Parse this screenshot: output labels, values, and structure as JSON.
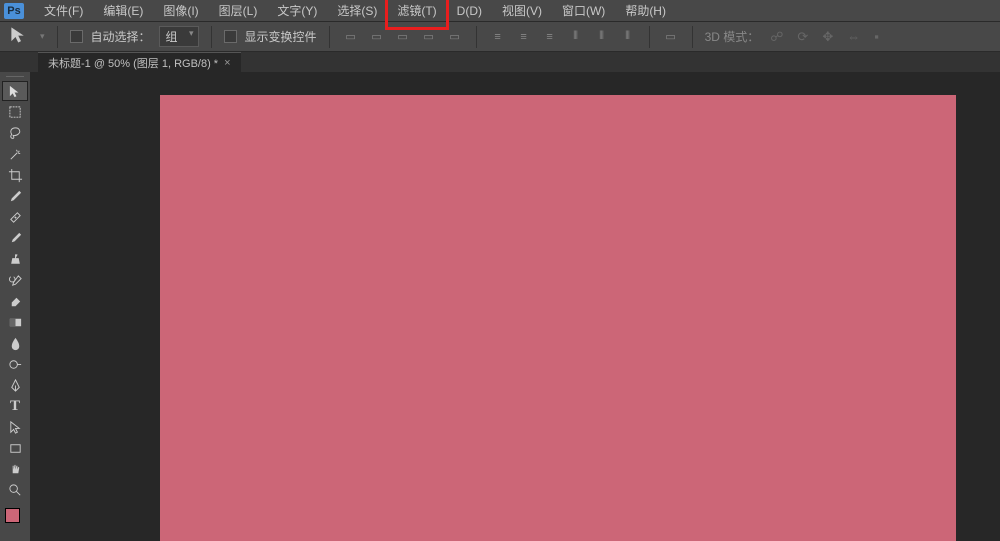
{
  "app": {
    "logo": "Ps"
  },
  "menubar": {
    "items": [
      "文件(F)",
      "编辑(E)",
      "图像(I)",
      "图层(L)",
      "文字(Y)",
      "选择(S)",
      "滤镜(T)",
      "D(D)",
      "视图(V)",
      "窗口(W)",
      "帮助(H)"
    ],
    "highlighted_index": 6
  },
  "options": {
    "auto_select_label": "自动选择：",
    "group_value": "组",
    "show_transform_label": "显示变换控件",
    "mode_3d_label": "3D 模式："
  },
  "document": {
    "tab_title": "未标题-1 @ 50% (图层 1, RGB/8) *",
    "canvas_fill": "#cc6677"
  },
  "toolbar": {
    "active_index": 0
  },
  "colors": {
    "foreground": "#cc6677"
  }
}
